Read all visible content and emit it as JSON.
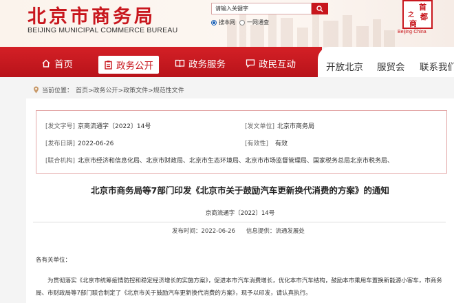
{
  "header": {
    "title": "北京市商务局",
    "subtitle": "BEIJING MUNICIPAL COMMERCE BUREAU",
    "search_placeholder": "请输入关键字",
    "radio_site": "搜本网",
    "radio_all": "一网通查",
    "seal": {
      "top1": "首",
      "top2": "之",
      "top3": "都",
      "top4": "商",
      "caption": "Beijing·China"
    }
  },
  "nav": {
    "items": [
      {
        "label": "首页",
        "icon": "home-icon"
      },
      {
        "label": "政务公开",
        "icon": "clipboard-icon"
      },
      {
        "label": "政务服务",
        "icon": "book-icon"
      },
      {
        "label": "政民互动",
        "icon": "chat-icon"
      }
    ],
    "external": [
      "开放北京",
      "服贸会",
      "联系我们"
    ]
  },
  "breadcrumb": {
    "prefix": "当前位置：",
    "path": "首页>政务公开>政策文件>规范性文件"
  },
  "meta": {
    "doc_number_key": "[发文字号]",
    "doc_number": "京商流通字〔2022〕14号",
    "issuer_key": "[发文单位]",
    "issuer": "北京市商务局",
    "date_key": "[发布日期]",
    "date": "2022-06-26",
    "validity_key": "[有效性]",
    "validity": "有效",
    "joint_key": "[联合机构]",
    "joint": "北京市经济和信息化局、北京市财政局、北京市生态环境局、北京市市场监督管理局、国家税务总局北京市税务局、"
  },
  "document": {
    "title": "北京市商务局等7部门印发《北京市关于鼓励汽车更新换代消费的方案》的通知",
    "number": "京商流通字〔2022〕14号",
    "publish_time": "发布时间：2022-06-26",
    "source": "信息提供：流通发展处",
    "salutation": "各有关单位：",
    "paragraph": "为贯彻落实《北京市统筹疫情防控和稳定经济增长的实施方案》，促进本市汽车消费增长，优化本市汽车结构，鼓励本市乘用车置换新能源小客车，市商务局、市财政局等7部门联合制定了《北京市关于鼓励汽车更新换代消费的方案》，现予以印发，请认真执行。"
  },
  "colors": {
    "brand_red": "#c8161d",
    "border_pink": "#e3a7a7"
  }
}
